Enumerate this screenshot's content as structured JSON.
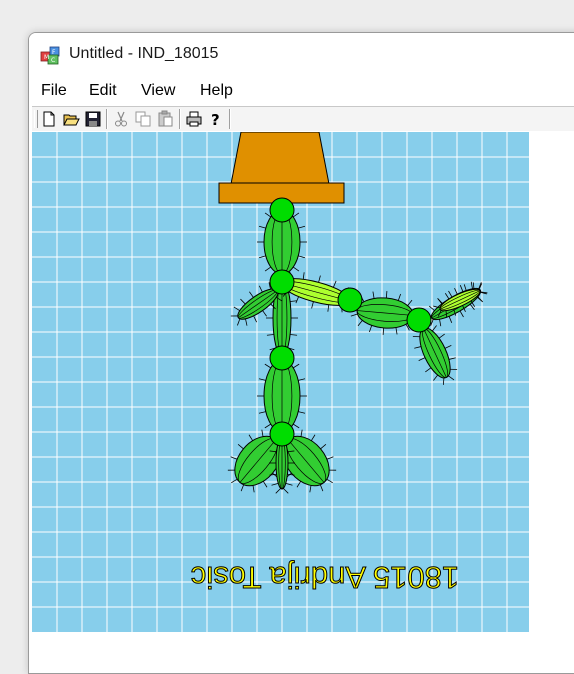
{
  "window": {
    "title": "Untitled - IND_18015"
  },
  "menu": {
    "file": "File",
    "edit": "Edit",
    "view": "View",
    "help": "Help"
  },
  "toolbar": {
    "buttons": [
      "new-icon",
      "open-icon",
      "save-icon",
      "cut-icon",
      "copy-icon",
      "paste-icon",
      "print-icon",
      "help-icon"
    ]
  },
  "drawing": {
    "caption": "18015 Andrija Tosic",
    "colors": {
      "background": "#87ceeb",
      "grid": "#ffffff",
      "pot": "#e09000",
      "cactus": "#32cd32",
      "joint": "#00dd00",
      "pale_segment": "#adff2f",
      "caption": "#ffff00"
    }
  }
}
